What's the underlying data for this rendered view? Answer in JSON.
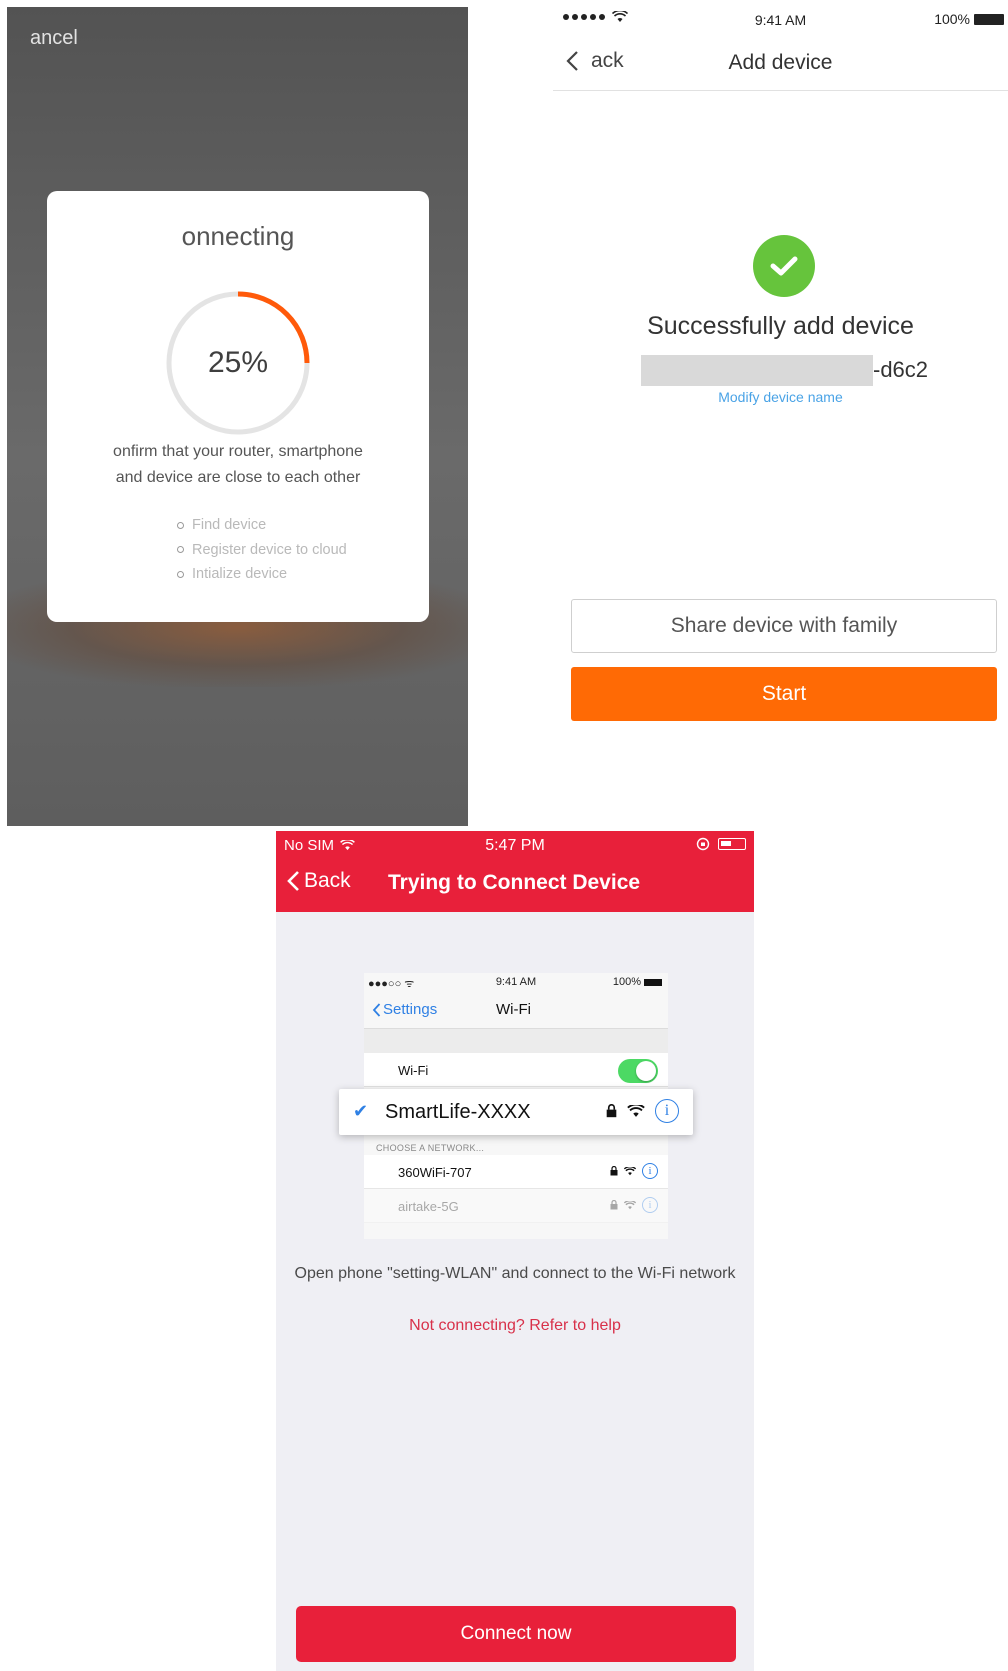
{
  "connecting_screen": {
    "cancel_label": "ancel",
    "title": "onnecting",
    "progress_value": 0.25,
    "progress_text": "25%",
    "progress_color": "#ff5a0a",
    "hint_line1": "onfirm that your router, smartphone",
    "hint_line2": "and device are close to each other",
    "steps": [
      "Find device",
      "Register device to cloud",
      "Intialize device"
    ]
  },
  "success_screen": {
    "status_bar": {
      "time": "9:41 AM",
      "battery": "100%"
    },
    "nav": {
      "back_label": "ack",
      "title": "Add device"
    },
    "success_text": "Successfully add device",
    "device_name_suffix": "-d6c2",
    "modify_link": "Modify device name",
    "share_button": "Share device with family",
    "start_button": "Start",
    "accent_color": "#ff6a05",
    "success_color": "#66c43c"
  },
  "connect_screen": {
    "status_bar": {
      "carrier": "No SIM",
      "time": "5:47 PM"
    },
    "nav": {
      "back_label": "Back",
      "title": "Trying to Connect Device"
    },
    "illustration": {
      "status_time": "9:41 AM",
      "status_battery": "100%",
      "back_label": "Settings",
      "title": "Wi-Fi",
      "wifi_label": "Wi-Fi",
      "selected_network": "SmartLife-XXXX",
      "choose_label": "CHOOSE A NETWORK...",
      "networks": [
        "360WiFi-707",
        "airtake-5G"
      ]
    },
    "instruction": "Open phone \"setting-WLAN\" and connect to the Wi-Fi network",
    "help_link": "Not connecting? Refer to help",
    "connect_button": "Connect now",
    "brand_color": "#e8203a"
  }
}
